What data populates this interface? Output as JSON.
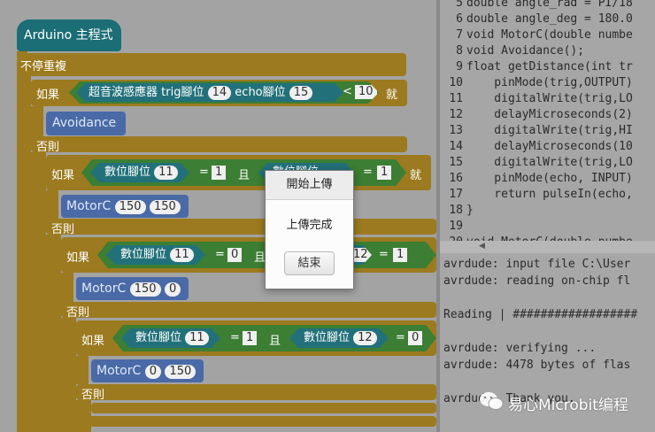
{
  "blocks": {
    "header": "Arduino 主程式",
    "loop": "不停重複",
    "if1": {
      "label": "如果",
      "sensor": "超音波感應器",
      "trig_label": "trig腳位",
      "trig": "14",
      "echo_label": "echo腳位",
      "echo": "15",
      "op": "<",
      "value": "10",
      "then": "就"
    },
    "avoidance": "Avoidance",
    "else1": "否則",
    "if2": {
      "label": "如果",
      "pin_label": "數位腳位",
      "pin": "11",
      "op": "=",
      "val": "1",
      "and": "且",
      "pin2_label": "數位腳位",
      "val2": "1",
      "then": "就"
    },
    "motor1": {
      "label": "MotorC",
      "a": "150",
      "b": "150"
    },
    "else2": "否則",
    "if3": {
      "label": "如果",
      "pin_label": "數位腳位",
      "pin": "11",
      "op": "=",
      "val": "0",
      "and": "且",
      "pin2": "12",
      "val2": "1"
    },
    "motor2": {
      "label": "MotorC",
      "a": "150",
      "b": "0"
    },
    "else3": "否則",
    "if4": {
      "label": "如果",
      "pin_label": "數位腳位",
      "pin": "11",
      "op": "=",
      "val": "1",
      "and": "且",
      "pin2_label": "數位腳位",
      "pin2": "12",
      "op2": "=",
      "val2": "0"
    },
    "motor3": {
      "label": "MotorC",
      "a": "0",
      "b": "150"
    },
    "else4": "否則"
  },
  "code": {
    "lines": [
      {
        "n": "5",
        "t": "double angle_rad = PI/18"
      },
      {
        "n": "6",
        "t": "double angle_deg = 180.0"
      },
      {
        "n": "7",
        "t": "void MotorC(double numbe"
      },
      {
        "n": "8",
        "t": "void Avoidance();"
      },
      {
        "n": "9",
        "t": "float getDistance(int tr"
      },
      {
        "n": "10",
        "t": "    pinMode(trig,OUTPUT)"
      },
      {
        "n": "11",
        "t": "    digitalWrite(trig,LO"
      },
      {
        "n": "12",
        "t": "    delayMicroseconds(2)"
      },
      {
        "n": "13",
        "t": "    digitalWrite(trig,HI"
      },
      {
        "n": "14",
        "t": "    delayMicroseconds(10"
      },
      {
        "n": "15",
        "t": "    digitalWrite(trig,LO"
      },
      {
        "n": "16",
        "t": "    pinMode(echo, INPUT)"
      },
      {
        "n": "17",
        "t": "    return pulseIn(echo,"
      },
      {
        "n": "18",
        "t": "}"
      },
      {
        "n": "19",
        "t": ""
      },
      {
        "n": "20",
        "t": "void MotorC(double numbe"
      }
    ]
  },
  "console": {
    "lines": [
      "avrdude: input file C:\\User",
      "avrdude: reading on-chip fl",
      "",
      "Reading | ##################",
      "",
      "avrdude: verifying ...",
      "avrdude: 4478 bytes of flas",
      "",
      "avrdude: Thank you."
    ]
  },
  "dialog": {
    "title": "開始上傳",
    "message": "上傳完成",
    "button": "結束"
  },
  "watermark": "易心Microbit编程"
}
